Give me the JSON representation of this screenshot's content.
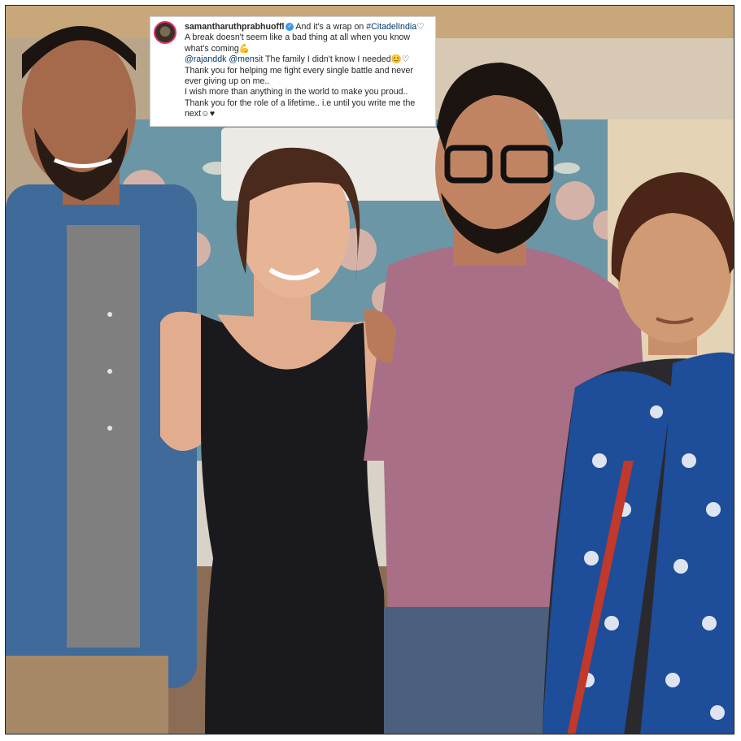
{
  "post": {
    "username": "samantharuthprabhuoffl",
    "verified_icon": "verified-badge-icon",
    "caption_lines": [
      "And it's a wrap on ",
      "#CitadelIndia",
      "A break doesn't seem like a bad thing at all when you know what's coming",
      "@rajanddk",
      "@mensit",
      " The family I didn't know I needed",
      "Thank you for helping me fight every single battle and never ever giving up on me..",
      "I wish more than anything in the world to make you proud..",
      "Thank you for the role of a lifetime.. i.e until you write me the next"
    ],
    "emojis": {
      "heart": "♡",
      "muscle": "💪",
      "smile": "😊",
      "black_heart": "♥",
      "grin": "☺"
    }
  },
  "colors": {
    "wall_floral": "#5f8fa0",
    "denim": "#3f6a99",
    "dress": "#1a1a1e",
    "tshirt": "#a86f86",
    "scarf": "#1e4d9a"
  }
}
